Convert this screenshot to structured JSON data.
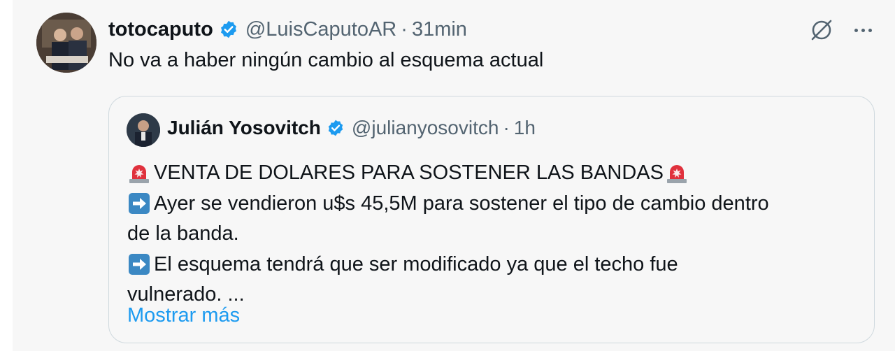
{
  "tweet": {
    "display_name": "totocaputo",
    "handle": "@LuisCaputoAR",
    "separator": "·",
    "time": "31min",
    "text": "No va a haber ningún cambio al esquema actual",
    "verified_color": "#1d9bf0"
  },
  "quote": {
    "display_name": "Julián Yosovitch",
    "handle": "@julianyosovitch",
    "separator": "·",
    "time": "1h",
    "lines": [
      {
        "emoji": "rotating-light-icon",
        "text": "VENTA DE DOLARES PARA SOSTENER LAS BANDAS",
        "trailing_emoji": "rotating-light-icon"
      },
      {
        "emoji": "right-arrow-icon",
        "text": "Ayer se vendieron u$s 45,5M para sostener el tipo de cambio dentro"
      },
      {
        "emoji": "",
        "text": "de la banda."
      },
      {
        "emoji": "right-arrow-icon",
        "text": "El esquema tendrá que ser modificado ya que el techo fue"
      },
      {
        "emoji": "",
        "text": "vulnerado. ..."
      }
    ],
    "show_more": "Mostrar más",
    "link_color": "#1d9bf0"
  },
  "icons": {
    "grok": "grok-icon",
    "more": "more-icon"
  }
}
